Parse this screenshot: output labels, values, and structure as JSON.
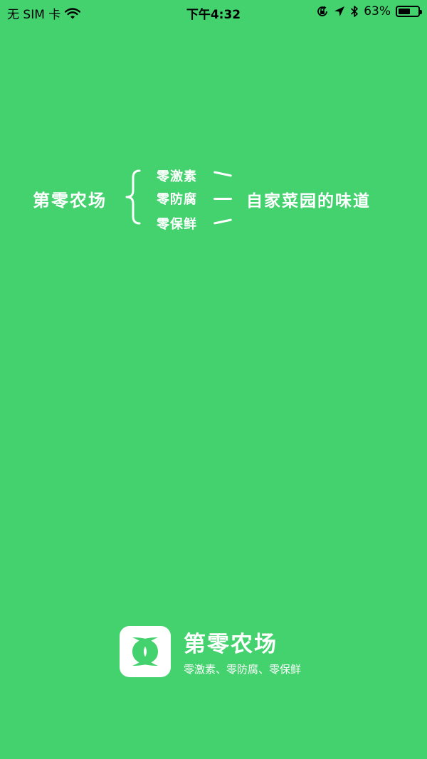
{
  "status_bar": {
    "carrier": "无 SIM 卡",
    "time": "下午4:32",
    "battery": "63%",
    "battery_level": 0.63,
    "icons": [
      "wifi-icon",
      "rotation-lock-icon",
      "location-arrow-icon",
      "bluetooth-icon",
      "battery-icon"
    ]
  },
  "slogan": {
    "brand": "第零农场",
    "features": [
      "零激素",
      "零防腐",
      "零保鲜"
    ],
    "tagline": "自家菜园的味道"
  },
  "footer": {
    "app_name": "第零农场",
    "subtitle": "零激素、零防腐、零保鲜"
  },
  "colors": {
    "background": "#43d26e",
    "foreground": "#ffffff",
    "status_text": "#000000"
  }
}
